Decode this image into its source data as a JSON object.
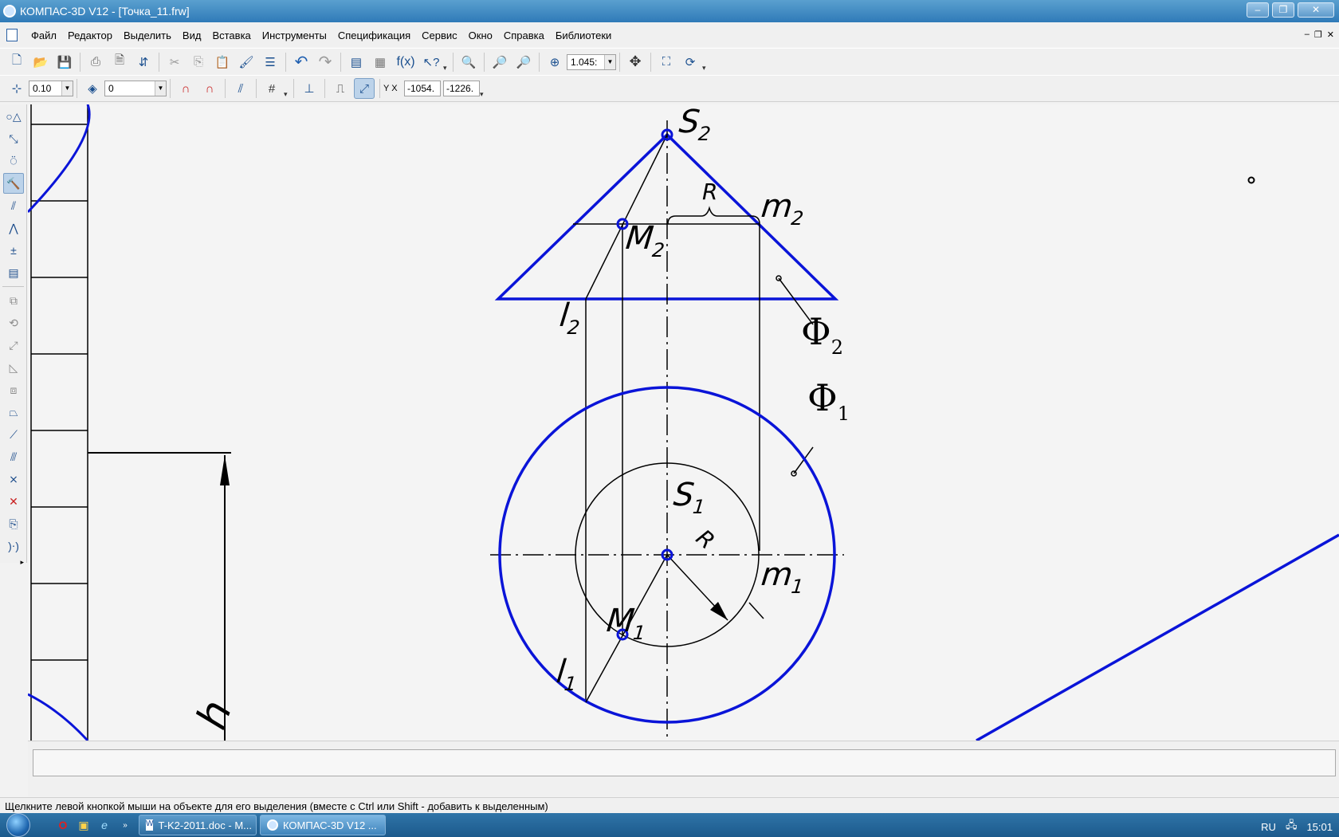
{
  "window": {
    "title": "КОМПАС-3D V12 - [Точка_11.frw]"
  },
  "menu": {
    "items": [
      "Файл",
      "Редактор",
      "Выделить",
      "Вид",
      "Вставка",
      "Инструменты",
      "Спецификация",
      "Сервис",
      "Окно",
      "Справка",
      "Библиотеки"
    ]
  },
  "toolbar": {
    "zoom_value": "1.045:",
    "fx_label": "f(x)"
  },
  "toolbar2": {
    "step_value": "0.10",
    "layer_value": "0",
    "yx_label": "Y X",
    "coord_x": "-1054.",
    "coord_y": "-1226."
  },
  "drawing": {
    "labels": {
      "s2": "S",
      "s2_sub": "2",
      "m2": "M",
      "m2_sub": "2",
      "mm2": "m",
      "mm2_sub": "2",
      "l2": "l",
      "l2_sub": "2",
      "phi2": "Φ",
      "phi2_sub": "2",
      "phi1": "Φ",
      "phi1_sub": "1",
      "s1": "S",
      "s1_sub": "1",
      "m1": "M",
      "m1_sub": "1",
      "mm1": "m",
      "mm1_sub": "1",
      "l1": "l",
      "l1_sub": "1",
      "r_top": "R",
      "r_bottom": "R",
      "h": "h"
    },
    "colors": {
      "contour": "#0a14d8",
      "line": "#000000"
    }
  },
  "status": {
    "text": "Щелкните левой кнопкой мыши на объекте для его выделения (вместе с Ctrl или Shift - добавить к выделенным)"
  },
  "taskbar": {
    "tasks": [
      {
        "label": "T-K2-2011.doc - M..."
      },
      {
        "label": "КОМПАС-3D V12 ..."
      }
    ],
    "lang": "RU",
    "clock": "15:01"
  }
}
